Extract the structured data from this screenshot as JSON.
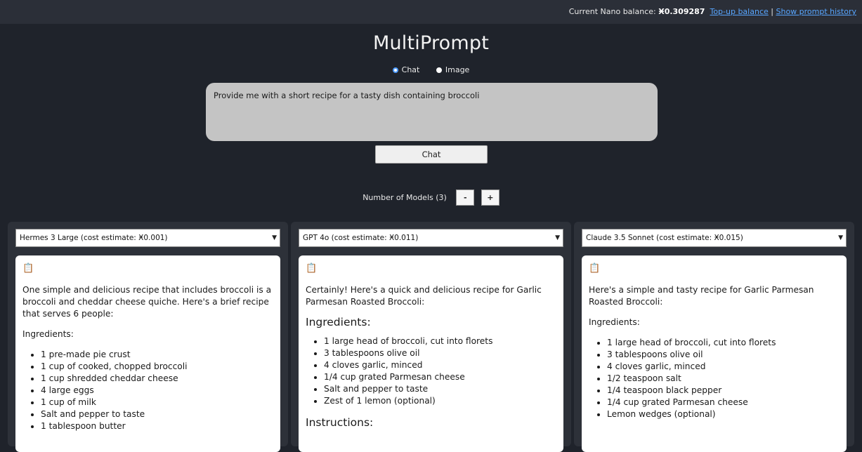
{
  "topbar": {
    "balance_label": "Current Nano balance:",
    "balance_value": "Ӿ0.309287",
    "topup": "Top-up balance",
    "separator": "|",
    "history": "Show prompt history"
  },
  "app_title": "MultiPrompt",
  "modes": {
    "chat": "Chat",
    "image": "Image",
    "selected": "chat"
  },
  "prompt": {
    "value": "Provide me with a short recipe for a tasty dish containing broccoli"
  },
  "chat_button": "Chat",
  "models_control": {
    "label": "Number of Models (3)",
    "minus": "-",
    "plus": "+"
  },
  "panels": [
    {
      "model": "Hermes 3 Large (cost estimate: Ӿ0.001)",
      "intro": "One simple and delicious recipe that includes broccoli is a broccoli and cheddar cheese quiche. Here's a brief recipe that serves 6 people:",
      "heading": "Ingredients:",
      "items": [
        "1 pre-made pie crust",
        "1 cup of cooked, chopped broccoli",
        "1 cup shredded cheddar cheese",
        "4 large eggs",
        "1 cup of milk",
        "Salt and pepper to taste",
        "1 tablespoon butter"
      ]
    },
    {
      "model": "GPT 4o (cost estimate: Ӿ0.011)",
      "intro": "Certainly! Here's a quick and delicious recipe for Garlic Parmesan Roasted Broccoli:",
      "heading": "Ingredients:",
      "items": [
        "1 large head of broccoli, cut into florets",
        "3 tablespoons olive oil",
        "4 cloves garlic, minced",
        "1/4 cup grated Parmesan cheese",
        "Salt and pepper to taste",
        "Zest of 1 lemon (optional)"
      ],
      "after": "Instructions:"
    },
    {
      "model": "Claude 3.5 Sonnet (cost estimate: Ӿ0.015)",
      "intro": "Here's a simple and tasty recipe for Garlic Parmesan Roasted Broccoli:",
      "heading": "Ingredients:",
      "items": [
        "1 large head of broccoli, cut into florets",
        "3 tablespoons olive oil",
        "4 cloves garlic, minced",
        "1/2 teaspoon salt",
        "1/4 teaspoon black pepper",
        "1/4 cup grated Parmesan cheese",
        "Lemon wedges (optional)"
      ]
    }
  ],
  "icons": {
    "copy": "clipboard-icon",
    "dropdown": "chevron-down-icon"
  }
}
